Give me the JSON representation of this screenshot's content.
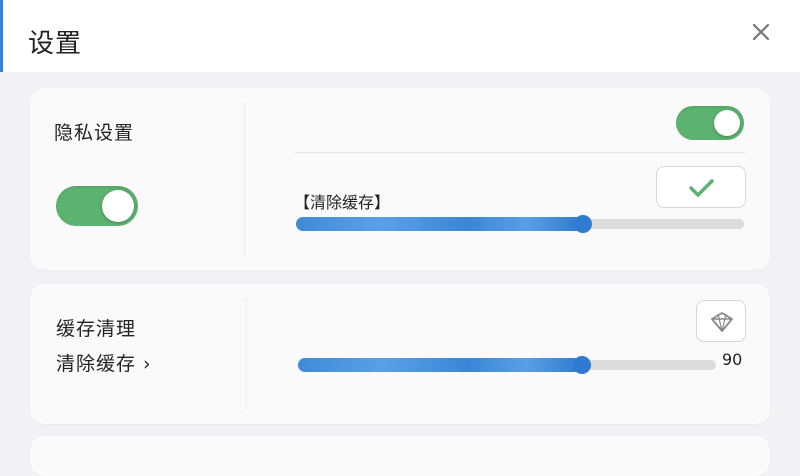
{
  "header": {
    "title": "设置",
    "close_icon": "close-icon"
  },
  "privacy": {
    "label": "隐私设置",
    "toggle_on": true,
    "right_toggle_on": true,
    "clear_cache_label": "【清除缓存】",
    "confirm_icon": "check-icon",
    "slider_level": 0.64
  },
  "cache": {
    "label": "缓存清理",
    "link_label": "清除缓存 ›",
    "badge_icon": "diamond-icon",
    "slider_level": 0.68,
    "slider_value": "90"
  },
  "colors": {
    "accent": "#3b7de0",
    "toggle_on": "#5cb270",
    "check": "#5cb270"
  }
}
